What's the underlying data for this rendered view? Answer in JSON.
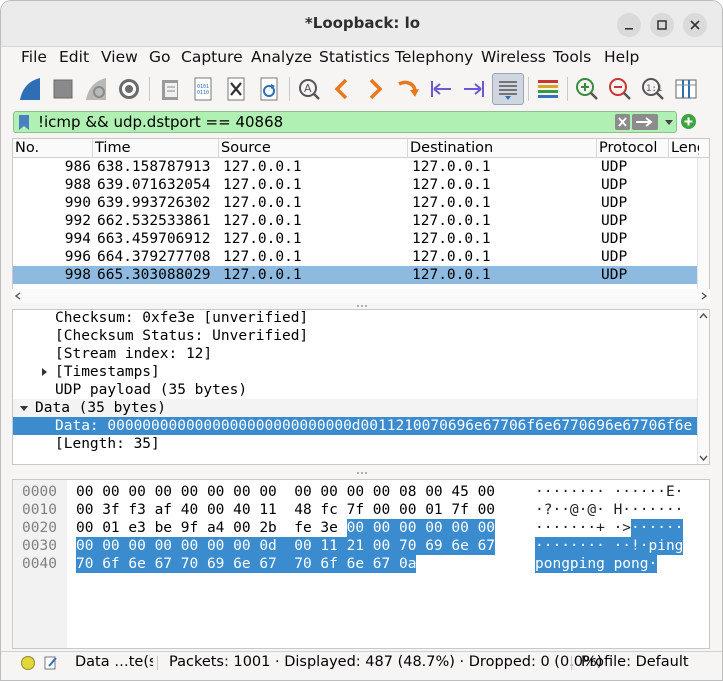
{
  "window": {
    "title": "*Loopback: lo"
  },
  "menubar": {
    "items": [
      "File",
      "Edit",
      "View",
      "Go",
      "Capture",
      "Analyze",
      "Statistics",
      "Telephony",
      "Wireless",
      "Tools",
      "Help"
    ]
  },
  "toolbar": {
    "icons": [
      "start-capture-icon",
      "stop-capture-icon",
      "restart-capture-icon",
      "capture-options-icon",
      "open-file-icon",
      "save-file-icon",
      "close-file-icon",
      "reload-file-icon",
      "find-packet-icon",
      "go-back-icon",
      "go-forward-icon",
      "go-to-packet-icon",
      "first-packet-icon",
      "last-packet-icon",
      "autoscroll-icon",
      "colorize-icon",
      "zoom-in-icon",
      "zoom-out-icon",
      "normal-size-icon",
      "resize-columns-icon"
    ]
  },
  "filter": {
    "value": "!icmp && udp.dstport == 40868"
  },
  "packet_list": {
    "columns": [
      "No.",
      "Time",
      "Source",
      "Destination",
      "Protocol",
      "Leng"
    ],
    "rows": [
      {
        "no": "986",
        "time": "638.158787913",
        "src": "127.0.0.1",
        "dst": "127.0.0.1",
        "proto": "UDP",
        "selected": false
      },
      {
        "no": "988",
        "time": "639.071632054",
        "src": "127.0.0.1",
        "dst": "127.0.0.1",
        "proto": "UDP",
        "selected": false
      },
      {
        "no": "990",
        "time": "639.993726302",
        "src": "127.0.0.1",
        "dst": "127.0.0.1",
        "proto": "UDP",
        "selected": false
      },
      {
        "no": "992",
        "time": "662.532533861",
        "src": "127.0.0.1",
        "dst": "127.0.0.1",
        "proto": "UDP",
        "selected": false
      },
      {
        "no": "994",
        "time": "663.459706912",
        "src": "127.0.0.1",
        "dst": "127.0.0.1",
        "proto": "UDP",
        "selected": false
      },
      {
        "no": "996",
        "time": "664.379277708",
        "src": "127.0.0.1",
        "dst": "127.0.0.1",
        "proto": "UDP",
        "selected": false
      },
      {
        "no": "998",
        "time": "665.303088029",
        "src": "127.0.0.1",
        "dst": "127.0.0.1",
        "proto": "UDP",
        "selected": true
      }
    ]
  },
  "details": {
    "lines": [
      {
        "text": "Checksum: 0xfe3e [unverified]",
        "arrow": ""
      },
      {
        "text": "[Checksum Status: Unverified]",
        "arrow": ""
      },
      {
        "text": "[Stream index: 12]",
        "arrow": ""
      },
      {
        "text": "[Timestamps]",
        "arrow": "collapsed"
      },
      {
        "text": "UDP payload (35 bytes)",
        "arrow": ""
      },
      {
        "text": "Data (35 bytes)",
        "arrow": "expanded"
      },
      {
        "text": "Data: 0000000000000000000000000000d0011210070696e67706f6e6770696e67706f6e",
        "arrow": ""
      },
      {
        "text": "[Length: 35]",
        "arrow": ""
      }
    ]
  },
  "bytes": {
    "rows": [
      {
        "offset": "0000",
        "hex_plain": "00 00 00 00 00 00 00 00  00 00 00 00 08 00 45 00",
        "hex_hl": "",
        "ascii_plain": "········ ······E·",
        "ascii_hl": ""
      },
      {
        "offset": "0010",
        "hex_plain": "00 3f f3 af 40 00 40 11  48 fc 7f 00 00 01 7f 00",
        "hex_hl": "",
        "ascii_plain": "·?··@·@· H·······",
        "ascii_hl": ""
      },
      {
        "offset": "0020",
        "hex_plain": "00 01 e3 be 9f a4 00 2b  fe 3e ",
        "hex_hl": "00 00 00 00 00 00",
        "ascii_plain": "·······+ ·>",
        "ascii_hl": "······"
      },
      {
        "offset": "0030",
        "hex_plain": "",
        "hex_hl": "00 00 00 00 00 00 00 0d  00 11 21 00 70 69 6e 67",
        "ascii_plain": "",
        "ascii_hl": "········ ··!·ping"
      },
      {
        "offset": "0040",
        "hex_plain": "",
        "hex_hl": "70 6f 6e 67 70 69 6e 67  70 6f 6e 67 0a",
        "ascii_plain": "",
        "ascii_hl": "pongping pong·"
      }
    ]
  },
  "status": {
    "field": "Data …te(s)",
    "packets": "Packets: 1001 · Displayed: 487 (48.7%) · Dropped: 0 (0.0%)",
    "profile": "Profile: Default"
  },
  "colors": {
    "filter_ok": "#b0f1b3",
    "selected_row": "#8fbadf",
    "selected_field": "#3a8ccf",
    "accent": "#2f6eb5"
  }
}
